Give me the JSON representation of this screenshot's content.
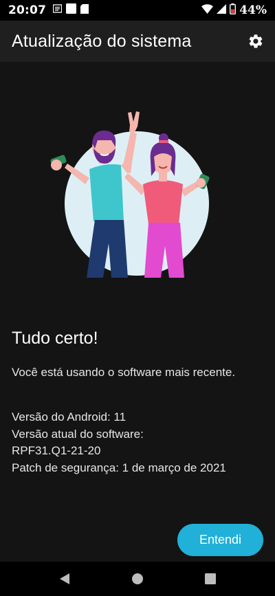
{
  "status_bar": {
    "time": "20:07",
    "battery": "44%",
    "icons": [
      "notification-icon",
      "square-icon",
      "sd-card-icon",
      "wifi-icon",
      "signal-icon",
      "battery-icon"
    ]
  },
  "app_bar": {
    "title": "Atualização do sistema",
    "settings_icon": "gear-icon"
  },
  "main": {
    "heading": "Tudo certo!",
    "description": "Você está usando o software mais recente.",
    "android_version": "Versão do Android: 11",
    "software_version_label": "Versão atual do software:",
    "software_version_value": "RPF31.Q1-21-20",
    "security_patch": "Patch de segurança: 1 de março de 2021",
    "ok_button": "Entendi"
  },
  "nav_bar": {
    "icons": [
      "back-icon",
      "home-icon",
      "recents-icon"
    ]
  },
  "colors": {
    "accent": "#20b0d8",
    "app_bar": "#1f1f1f",
    "background": "#141414"
  }
}
